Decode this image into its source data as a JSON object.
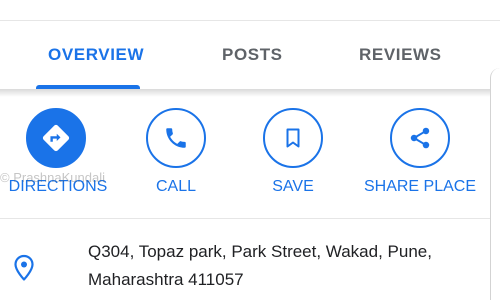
{
  "tabs": [
    {
      "label": "OVERVIEW",
      "active": true
    },
    {
      "label": "POSTS",
      "active": false
    },
    {
      "label": "REVIEWS",
      "active": false
    }
  ],
  "actions": [
    {
      "label": "DIRECTIONS",
      "icon": "directions-icon"
    },
    {
      "label": "CALL",
      "icon": "phone-icon"
    },
    {
      "label": "SAVE",
      "icon": "bookmark-icon"
    },
    {
      "label": "SHARE PLACE",
      "icon": "share-icon"
    }
  ],
  "watermark": "© PrashnaKundali",
  "address": {
    "icon": "location-pin-icon",
    "line1": "Q304, Topaz park, Park Street, Wakad, Pune,",
    "line2": "Maharashtra 411057"
  },
  "colors": {
    "accent": "#1a73e8",
    "inactive_tab": "#5f6368",
    "text": "#202124"
  }
}
